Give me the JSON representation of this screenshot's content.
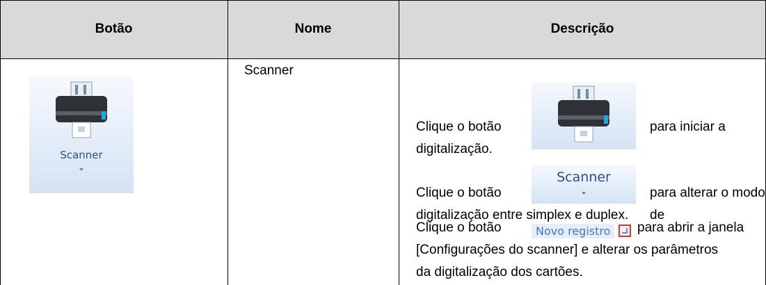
{
  "table": {
    "headers": [
      "Botão",
      "Nome",
      "Descrição"
    ],
    "row": {
      "button_label": "Scanner",
      "name": "Scanner",
      "desc1_pre": "Clique o botão",
      "desc1_post": "para iniciar a",
      "desc1_line2": "digitalização.",
      "desc2_button_label": "Scanner",
      "desc2_pre": "Clique o botão",
      "desc2_post": "para alterar o modo de",
      "desc2_line2": "digitalização entre simplex e duplex.",
      "desc3_pre": "Clique o botão",
      "desc3_button_label": "Novo registro",
      "desc3_post": "para abrir a janela",
      "desc3_line2": "[Configurações do scanner] e alterar os parâmetros",
      "desc3_line3": "da digitalização dos cartões."
    }
  },
  "colors": {
    "header_bg": "#d9d9d9",
    "button_text": "#2f4f88",
    "link_button_text": "#4a74c4",
    "icon_border": "#e03030"
  }
}
